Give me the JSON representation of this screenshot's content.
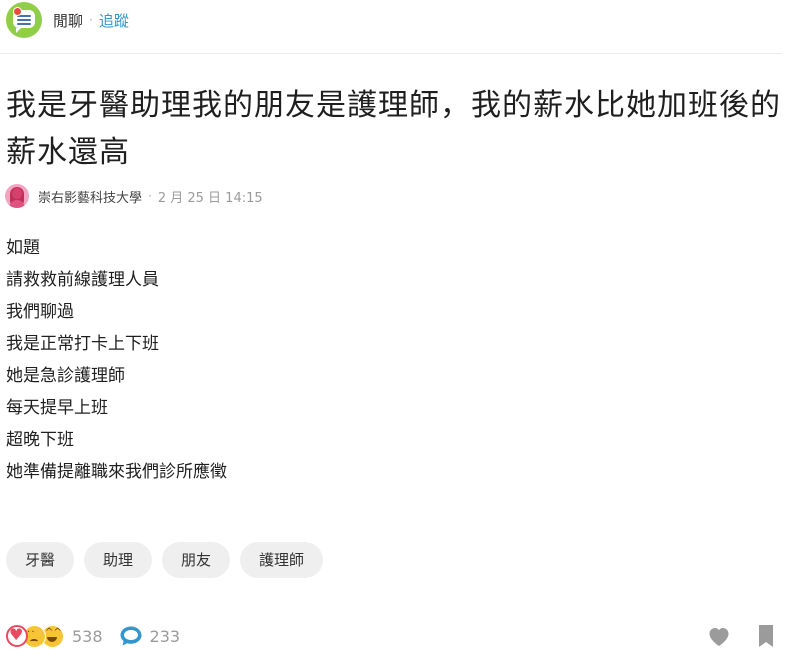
{
  "forum": {
    "name": "閒聊",
    "follow_label": "追蹤"
  },
  "post": {
    "title": "我是牙醫助理我的朋友是護理師，我的薪水比她加班後的薪水還高",
    "author_school": "崇右影藝科技大學",
    "date": "2 月 25 日 14:15",
    "content_lines": [
      "如題",
      "請救救前線護理人員",
      "我們聊過",
      "我是正常打卡上下班",
      "她是急診護理師",
      "每天提早上班",
      "超晚下班",
      "她準備提離職來我們診所應徵"
    ],
    "tags": [
      "牙醫",
      "助理",
      "朋友",
      "護理師"
    ]
  },
  "stats": {
    "reactions_count": "538",
    "comments_count": "233"
  },
  "icons": {
    "forum_logo": "forum-chat-icon",
    "reactions": [
      "heart-reaction-icon",
      "sad-reaction-icon",
      "laugh-reaction-icon"
    ],
    "comment": "comment-icon",
    "like": "heart-icon",
    "bookmark": "bookmark-icon"
  },
  "colors": {
    "accent": "#3397cf",
    "forum_logo": "#8fce46",
    "heart": "#e84a5f",
    "comment_icon": "#3397cf",
    "footer_icons": "#9b9b9b",
    "tag_bg": "#efefef"
  }
}
